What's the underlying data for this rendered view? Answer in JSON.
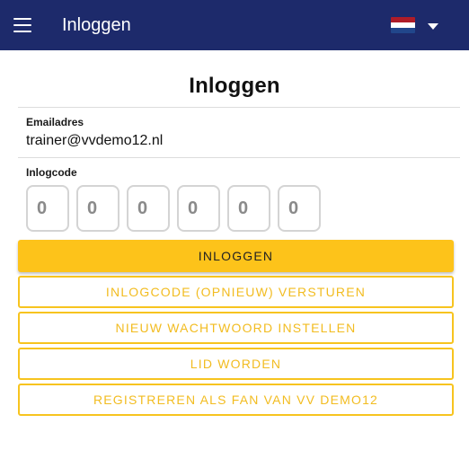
{
  "appbar": {
    "title": "Inloggen",
    "background": "#1d2a6b",
    "menu_icon": "hamburger-menu-icon",
    "language": {
      "flag": "netherlands-flag",
      "flag_colors": [
        "#ae1c28",
        "#ffffff",
        "#21468b"
      ],
      "dropdown_icon": "caret-down-icon"
    }
  },
  "page": {
    "title": "Inloggen"
  },
  "email": {
    "label": "Emailadres",
    "value": "trainer@vvdemo12.nl"
  },
  "login_code": {
    "label": "Inlogcode",
    "digits": [
      "0",
      "0",
      "0",
      "0",
      "0",
      "0"
    ]
  },
  "buttons": {
    "login": "INLOGGEN",
    "resend_code": "INLOGCODE (OPNIEUW) VERSTUREN",
    "new_password": "NIEUW WACHTWOORD INSTELLEN",
    "become_member": "LID WORDEN",
    "register_fan": "REGISTREREN ALS FAN VAN VV DEMO12"
  },
  "colors": {
    "accent": "#fdc31a",
    "outline_text": "#f2bc20"
  }
}
